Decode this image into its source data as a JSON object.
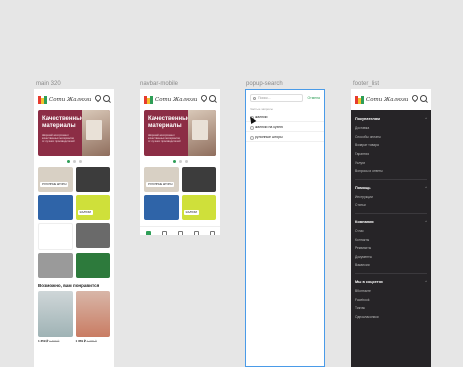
{
  "frames": {
    "main": "main 320",
    "navbar": "navbar-mobile",
    "popup": "popup-search",
    "footer": "footer_list"
  },
  "brand": {
    "name": "Соти Жалюзи"
  },
  "banner": {
    "title": "Качественные материалы",
    "subtitle": "Широкий ассортимент качественных материалов от лучших производителей"
  },
  "tiles": [
    {
      "label": "РУЛОННЫЕ ШТОРЫ",
      "color": "#d8d0c4"
    },
    {
      "label": "",
      "color": "#3c3c3c"
    },
    {
      "label": "",
      "color": "#2f64a8"
    },
    {
      "label": "ЖАЛЮЗИ",
      "color": "#cfe03a"
    },
    {
      "label": "",
      "color": "#ffffff"
    },
    {
      "label": "",
      "color": "#6a6a6a"
    },
    {
      "label": "",
      "color": "#9a9a9a"
    },
    {
      "label": "",
      "color": "#2d7a3c"
    }
  ],
  "nav_tiles": [
    {
      "label": "РУЛОННЫЕ ШТОРЫ",
      "color": "#d8d0c4"
    },
    {
      "label": "",
      "color": "#3c3c3c"
    },
    {
      "label": "",
      "color": "#2f64a8"
    },
    {
      "label": "ЖАЛЮЗИ",
      "color": "#cfe03a"
    }
  ],
  "section": {
    "title": "Возможно, вам понравится"
  },
  "products": [
    {
      "price": "1 359 ₽",
      "old_price": "1 499 ₽"
    },
    {
      "price": "1 359 ₽",
      "old_price": "1 499 ₽"
    }
  ],
  "search": {
    "placeholder": "Поиск...",
    "cancel": "Отмена",
    "history_title": "Частые запросы",
    "items": [
      "жалюзи",
      "жалюзи на кухню",
      "рулонные шторы"
    ]
  },
  "footer": {
    "sections": [
      {
        "title": "Покупателям",
        "items": [
          "Доставка",
          "Способы оплаты",
          "Возврат товара",
          "Гарантия",
          "Услуги",
          "Вопросы и ответы"
        ]
      },
      {
        "title": "Помощь",
        "items": [
          "Инструкции",
          "Статьи"
        ]
      },
      {
        "title": "Компания",
        "items": [
          "О нас",
          "Контакты",
          "Реквизиты",
          "Документы",
          "Вакансии"
        ]
      },
      {
        "title": "Мы в соцсетях",
        "items": [
          "ВКонтакте",
          "Facebook",
          "Тиктак",
          "Одноклассники"
        ]
      }
    ]
  },
  "colors": {
    "accent": "#2e9e57",
    "banner": "#8c2d45",
    "footer_bg": "#262427",
    "selection": "#4a9be8"
  }
}
